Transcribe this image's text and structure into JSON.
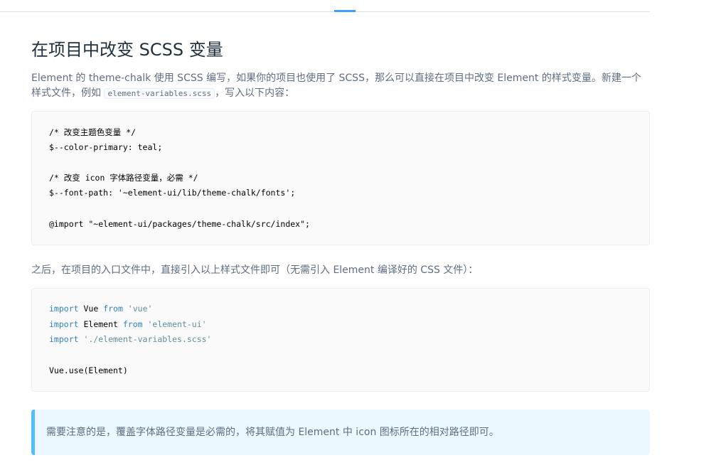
{
  "section": {
    "title": "在项目中改变 SCSS 变量",
    "intro_before": "Element 的 theme-chalk 使用 SCSS 编写，如果你的项目也使用了 SCSS，那么可以直接在项目中改变 Element 的样式变量。新建一个样式文件，例如 ",
    "intro_code": "element-variables.scss",
    "intro_after": "，写入以下内容：",
    "after_text": "之后，在项目的入口文件中，直接引入以上样式文件即可（无需引入 Element 编译好的 CSS 文件）：",
    "tip_text": "需要注意的是，覆盖字体路径变量是必需的，将其赋值为 Element 中 icon 图标所在的相对路径即可。"
  },
  "code_block_1": {
    "lines": [
      "/* 改变主题色变量 */",
      "$--color-primary: teal;",
      "",
      "/* 改变 icon 字体路径变量，必需 */",
      "$--font-path: '~element-ui/lib/theme-chalk/fonts';",
      "",
      "@import \"~element-ui/packages/theme-chalk/src/index\";"
    ]
  },
  "code_block_2": {
    "l1_kw": "import",
    "l1_mid": " Vue ",
    "l1_kw2": "from",
    "l1_str": " 'vue'",
    "l2_kw": "import",
    "l2_mid": " Element ",
    "l2_kw2": "from",
    "l2_str": " 'element-ui'",
    "l3_kw": "import",
    "l3_str": " './element-variables.scss'",
    "l5": "Vue.use(Element)"
  },
  "colors": {
    "accent": "#409eff",
    "tip_border": "#50bfff",
    "tip_bg": "#ecf8ff",
    "keyword": "#3182bd"
  }
}
